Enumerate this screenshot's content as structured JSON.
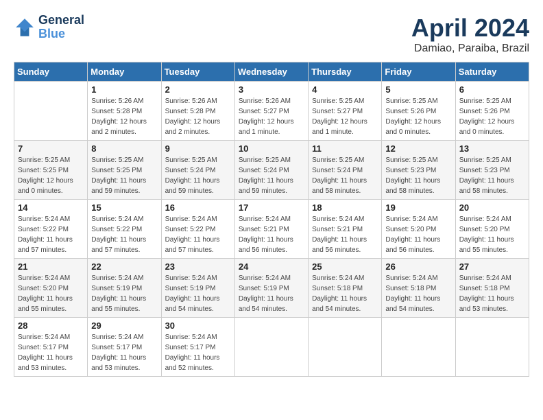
{
  "logo": {
    "line1": "General",
    "line2": "Blue"
  },
  "title": {
    "month": "April 2024",
    "location": "Damiao, Paraiba, Brazil"
  },
  "headers": [
    "Sunday",
    "Monday",
    "Tuesday",
    "Wednesday",
    "Thursday",
    "Friday",
    "Saturday"
  ],
  "weeks": [
    [
      {
        "day": "",
        "sunrise": "",
        "sunset": "",
        "daylight": ""
      },
      {
        "day": "1",
        "sunrise": "Sunrise: 5:26 AM",
        "sunset": "Sunset: 5:28 PM",
        "daylight": "Daylight: 12 hours and 2 minutes."
      },
      {
        "day": "2",
        "sunrise": "Sunrise: 5:26 AM",
        "sunset": "Sunset: 5:28 PM",
        "daylight": "Daylight: 12 hours and 2 minutes."
      },
      {
        "day": "3",
        "sunrise": "Sunrise: 5:26 AM",
        "sunset": "Sunset: 5:27 PM",
        "daylight": "Daylight: 12 hours and 1 minute."
      },
      {
        "day": "4",
        "sunrise": "Sunrise: 5:25 AM",
        "sunset": "Sunset: 5:27 PM",
        "daylight": "Daylight: 12 hours and 1 minute."
      },
      {
        "day": "5",
        "sunrise": "Sunrise: 5:25 AM",
        "sunset": "Sunset: 5:26 PM",
        "daylight": "Daylight: 12 hours and 0 minutes."
      },
      {
        "day": "6",
        "sunrise": "Sunrise: 5:25 AM",
        "sunset": "Sunset: 5:26 PM",
        "daylight": "Daylight: 12 hours and 0 minutes."
      }
    ],
    [
      {
        "day": "7",
        "sunrise": "Sunrise: 5:25 AM",
        "sunset": "Sunset: 5:25 PM",
        "daylight": "Daylight: 12 hours and 0 minutes."
      },
      {
        "day": "8",
        "sunrise": "Sunrise: 5:25 AM",
        "sunset": "Sunset: 5:25 PM",
        "daylight": "Daylight: 11 hours and 59 minutes."
      },
      {
        "day": "9",
        "sunrise": "Sunrise: 5:25 AM",
        "sunset": "Sunset: 5:24 PM",
        "daylight": "Daylight: 11 hours and 59 minutes."
      },
      {
        "day": "10",
        "sunrise": "Sunrise: 5:25 AM",
        "sunset": "Sunset: 5:24 PM",
        "daylight": "Daylight: 11 hours and 59 minutes."
      },
      {
        "day": "11",
        "sunrise": "Sunrise: 5:25 AM",
        "sunset": "Sunset: 5:24 PM",
        "daylight": "Daylight: 11 hours and 58 minutes."
      },
      {
        "day": "12",
        "sunrise": "Sunrise: 5:25 AM",
        "sunset": "Sunset: 5:23 PM",
        "daylight": "Daylight: 11 hours and 58 minutes."
      },
      {
        "day": "13",
        "sunrise": "Sunrise: 5:25 AM",
        "sunset": "Sunset: 5:23 PM",
        "daylight": "Daylight: 11 hours and 58 minutes."
      }
    ],
    [
      {
        "day": "14",
        "sunrise": "Sunrise: 5:24 AM",
        "sunset": "Sunset: 5:22 PM",
        "daylight": "Daylight: 11 hours and 57 minutes."
      },
      {
        "day": "15",
        "sunrise": "Sunrise: 5:24 AM",
        "sunset": "Sunset: 5:22 PM",
        "daylight": "Daylight: 11 hours and 57 minutes."
      },
      {
        "day": "16",
        "sunrise": "Sunrise: 5:24 AM",
        "sunset": "Sunset: 5:22 PM",
        "daylight": "Daylight: 11 hours and 57 minutes."
      },
      {
        "day": "17",
        "sunrise": "Sunrise: 5:24 AM",
        "sunset": "Sunset: 5:21 PM",
        "daylight": "Daylight: 11 hours and 56 minutes."
      },
      {
        "day": "18",
        "sunrise": "Sunrise: 5:24 AM",
        "sunset": "Sunset: 5:21 PM",
        "daylight": "Daylight: 11 hours and 56 minutes."
      },
      {
        "day": "19",
        "sunrise": "Sunrise: 5:24 AM",
        "sunset": "Sunset: 5:20 PM",
        "daylight": "Daylight: 11 hours and 56 minutes."
      },
      {
        "day": "20",
        "sunrise": "Sunrise: 5:24 AM",
        "sunset": "Sunset: 5:20 PM",
        "daylight": "Daylight: 11 hours and 55 minutes."
      }
    ],
    [
      {
        "day": "21",
        "sunrise": "Sunrise: 5:24 AM",
        "sunset": "Sunset: 5:20 PM",
        "daylight": "Daylight: 11 hours and 55 minutes."
      },
      {
        "day": "22",
        "sunrise": "Sunrise: 5:24 AM",
        "sunset": "Sunset: 5:19 PM",
        "daylight": "Daylight: 11 hours and 55 minutes."
      },
      {
        "day": "23",
        "sunrise": "Sunrise: 5:24 AM",
        "sunset": "Sunset: 5:19 PM",
        "daylight": "Daylight: 11 hours and 54 minutes."
      },
      {
        "day": "24",
        "sunrise": "Sunrise: 5:24 AM",
        "sunset": "Sunset: 5:19 PM",
        "daylight": "Daylight: 11 hours and 54 minutes."
      },
      {
        "day": "25",
        "sunrise": "Sunrise: 5:24 AM",
        "sunset": "Sunset: 5:18 PM",
        "daylight": "Daylight: 11 hours and 54 minutes."
      },
      {
        "day": "26",
        "sunrise": "Sunrise: 5:24 AM",
        "sunset": "Sunset: 5:18 PM",
        "daylight": "Daylight: 11 hours and 54 minutes."
      },
      {
        "day": "27",
        "sunrise": "Sunrise: 5:24 AM",
        "sunset": "Sunset: 5:18 PM",
        "daylight": "Daylight: 11 hours and 53 minutes."
      }
    ],
    [
      {
        "day": "28",
        "sunrise": "Sunrise: 5:24 AM",
        "sunset": "Sunset: 5:17 PM",
        "daylight": "Daylight: 11 hours and 53 minutes."
      },
      {
        "day": "29",
        "sunrise": "Sunrise: 5:24 AM",
        "sunset": "Sunset: 5:17 PM",
        "daylight": "Daylight: 11 hours and 53 minutes."
      },
      {
        "day": "30",
        "sunrise": "Sunrise: 5:24 AM",
        "sunset": "Sunset: 5:17 PM",
        "daylight": "Daylight: 11 hours and 52 minutes."
      },
      {
        "day": "",
        "sunrise": "",
        "sunset": "",
        "daylight": ""
      },
      {
        "day": "",
        "sunrise": "",
        "sunset": "",
        "daylight": ""
      },
      {
        "day": "",
        "sunrise": "",
        "sunset": "",
        "daylight": ""
      },
      {
        "day": "",
        "sunrise": "",
        "sunset": "",
        "daylight": ""
      }
    ]
  ]
}
